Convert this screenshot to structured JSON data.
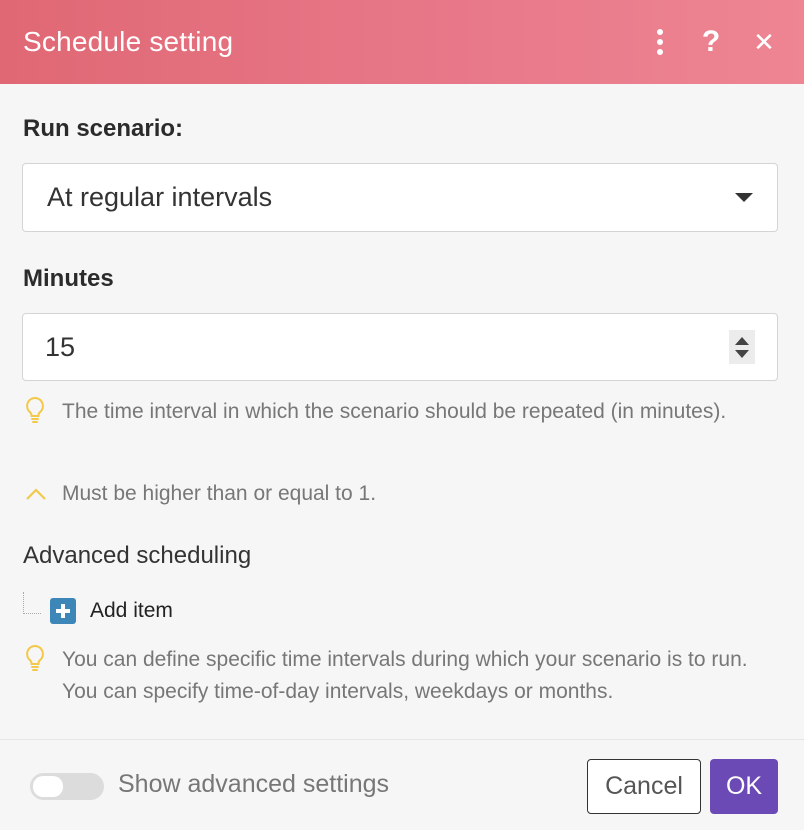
{
  "dialog": {
    "title": "Schedule setting"
  },
  "fields": {
    "run_scenario": {
      "label": "Run scenario:",
      "value": "At regular intervals"
    },
    "minutes": {
      "label": "Minutes",
      "value": "15",
      "hint": "The time interval in which the scenario should be repeated (in minutes).",
      "validation": "Must be higher than or equal to 1."
    }
  },
  "advanced_scheduling": {
    "title": "Advanced scheduling",
    "add_item_label": "Add item",
    "hint": "You can define specific time intervals during which your scenario is to run. You can specify time-of-day intervals, weekdays or months."
  },
  "footer": {
    "toggle_label": "Show advanced settings",
    "toggle_on": false,
    "cancel_label": "Cancel",
    "ok_label": "OK"
  },
  "colors": {
    "header_start": "#e06874",
    "header_end": "#ee8592",
    "ok_button": "#6c4ab6",
    "add_icon": "#3d86b8",
    "hint_icon": "#f2c94c"
  },
  "icons": {
    "header": [
      "more-vertical-icon",
      "help-icon",
      "close-icon"
    ],
    "select": "caret-down-icon",
    "hint": "lightbulb-icon",
    "validation": "chevron-up-icon",
    "add": "plus-square-icon"
  }
}
